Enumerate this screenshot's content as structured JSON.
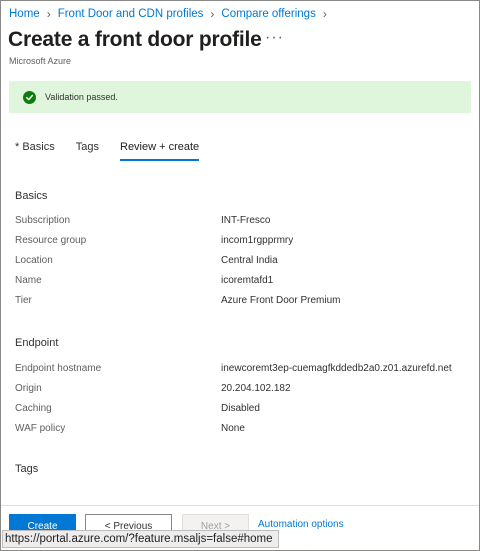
{
  "breadcrumb": [
    "Home",
    "Front Door and CDN profiles",
    "Compare offerings"
  ],
  "page": {
    "title": "Create a front door profile",
    "more": "···",
    "subtitle": "Microsoft Azure"
  },
  "validation": {
    "text": "Validation passed."
  },
  "tabs": [
    {
      "label": "* Basics",
      "active": false
    },
    {
      "label": "Tags",
      "active": false
    },
    {
      "label": "Review + create",
      "active": true
    }
  ],
  "basics": {
    "title": "Basics",
    "rows": [
      {
        "label": "Subscription",
        "value": "INT-Fresco"
      },
      {
        "label": "Resource group",
        "value": "incom1rgpprmry"
      },
      {
        "label": "Location",
        "value": "Central India"
      },
      {
        "label": "Name",
        "value": "icoremtafd1"
      },
      {
        "label": "Tier",
        "value": "Azure Front Door Premium"
      }
    ]
  },
  "endpoint": {
    "title": "Endpoint",
    "rows": [
      {
        "label": "Endpoint hostname",
        "value": "inewcoremt3ep-cuemagfkddedb2a0.z01.azurefd.net"
      },
      {
        "label": "Origin",
        "value": "20.204.102.182"
      },
      {
        "label": "Caching",
        "value": "Disabled"
      },
      {
        "label": "WAF policy",
        "value": "None"
      }
    ]
  },
  "tags": {
    "title": "Tags"
  },
  "footer": {
    "create": "Create",
    "previous": "< Previous",
    "next": "Next >",
    "automation": "Automation options"
  },
  "statusbar": {
    "url": "https://portal.azure.com/?feature.msaljs=false#home"
  },
  "colors": {
    "accent": "#0078d4",
    "success": "#107c10",
    "success_bg": "#dff6dd"
  },
  "icons": {
    "validation": "check-circle-icon"
  }
}
